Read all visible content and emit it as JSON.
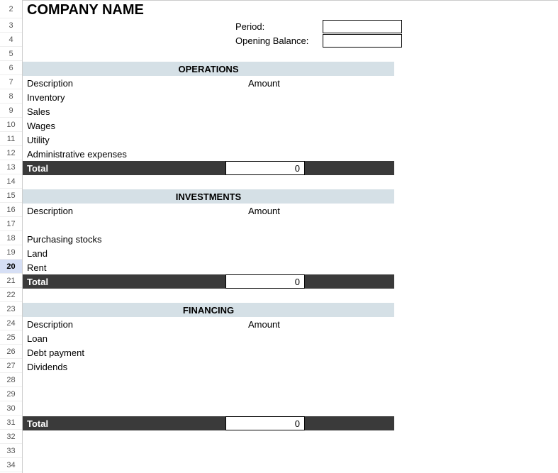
{
  "rows": [
    "2",
    "3",
    "4",
    "5",
    "6",
    "7",
    "8",
    "9",
    "10",
    "11",
    "12",
    "13",
    "14",
    "15",
    "16",
    "17",
    "18",
    "19",
    "20",
    "21",
    "22",
    "23",
    "24",
    "25",
    "26",
    "27",
    "28",
    "29",
    "30",
    "31",
    "32",
    "33",
    "34"
  ],
  "activeRow": "20",
  "title": "COMPANY NAME",
  "meta": {
    "period_label": "Period:",
    "period_value": "",
    "opening_label": "Opening Balance:",
    "opening_value": ""
  },
  "columns": {
    "description": "Description",
    "amount": "Amount"
  },
  "sections": {
    "operations": {
      "header": "OPERATIONS",
      "items": [
        "Inventory",
        "Sales",
        "Wages",
        "Utility",
        "Administrative expenses"
      ],
      "total_label": "Total",
      "total_value": "0"
    },
    "investments": {
      "header": "INVESTMENTS",
      "items": [
        "",
        "Purchasing stocks",
        "Land",
        "Rent"
      ],
      "total_label": "Total",
      "total_value": "0"
    },
    "financing": {
      "header": "FINANCING",
      "items": [
        "Loan",
        "Debt payment",
        "Dividends",
        "",
        "",
        ""
      ],
      "total_label": "Total",
      "total_value": "0"
    }
  }
}
